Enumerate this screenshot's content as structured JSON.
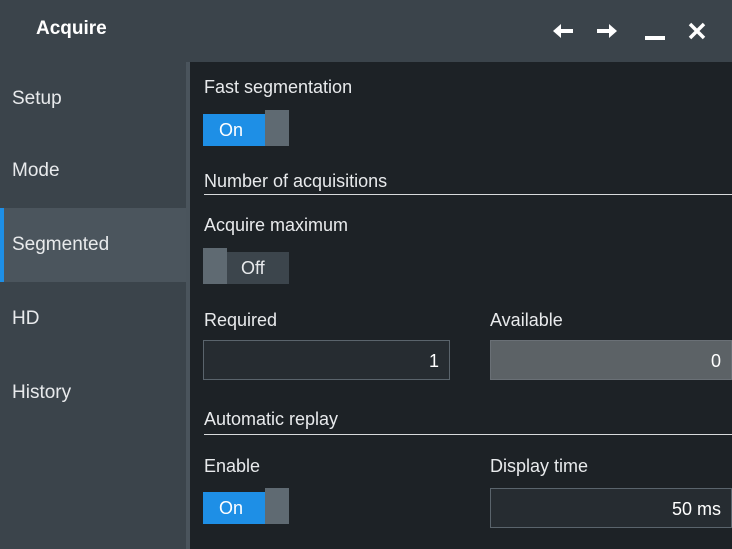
{
  "title": "Acquire",
  "sidebar": {
    "items": [
      {
        "label": "Setup"
      },
      {
        "label": "Mode"
      },
      {
        "label": "Segmented"
      },
      {
        "label": "HD"
      },
      {
        "label": "History"
      }
    ],
    "active": "Segmented"
  },
  "fast_segmentation": {
    "label": "Fast segmentation",
    "state": "On"
  },
  "num_acq": {
    "section": "Number of acquisitions",
    "acquire_max_label": "Acquire maximum",
    "acquire_max_state": "Off",
    "required_label": "Required",
    "required_value": "1",
    "available_label": "Available",
    "available_value": "0"
  },
  "auto_replay": {
    "section": "Automatic replay",
    "enable_label": "Enable",
    "enable_state": "On",
    "display_time_label": "Display time",
    "display_time_value": "50 ms"
  },
  "colors": {
    "accent": "#1e8fe6",
    "panel": "#3b444b",
    "background": "#1d2226"
  }
}
